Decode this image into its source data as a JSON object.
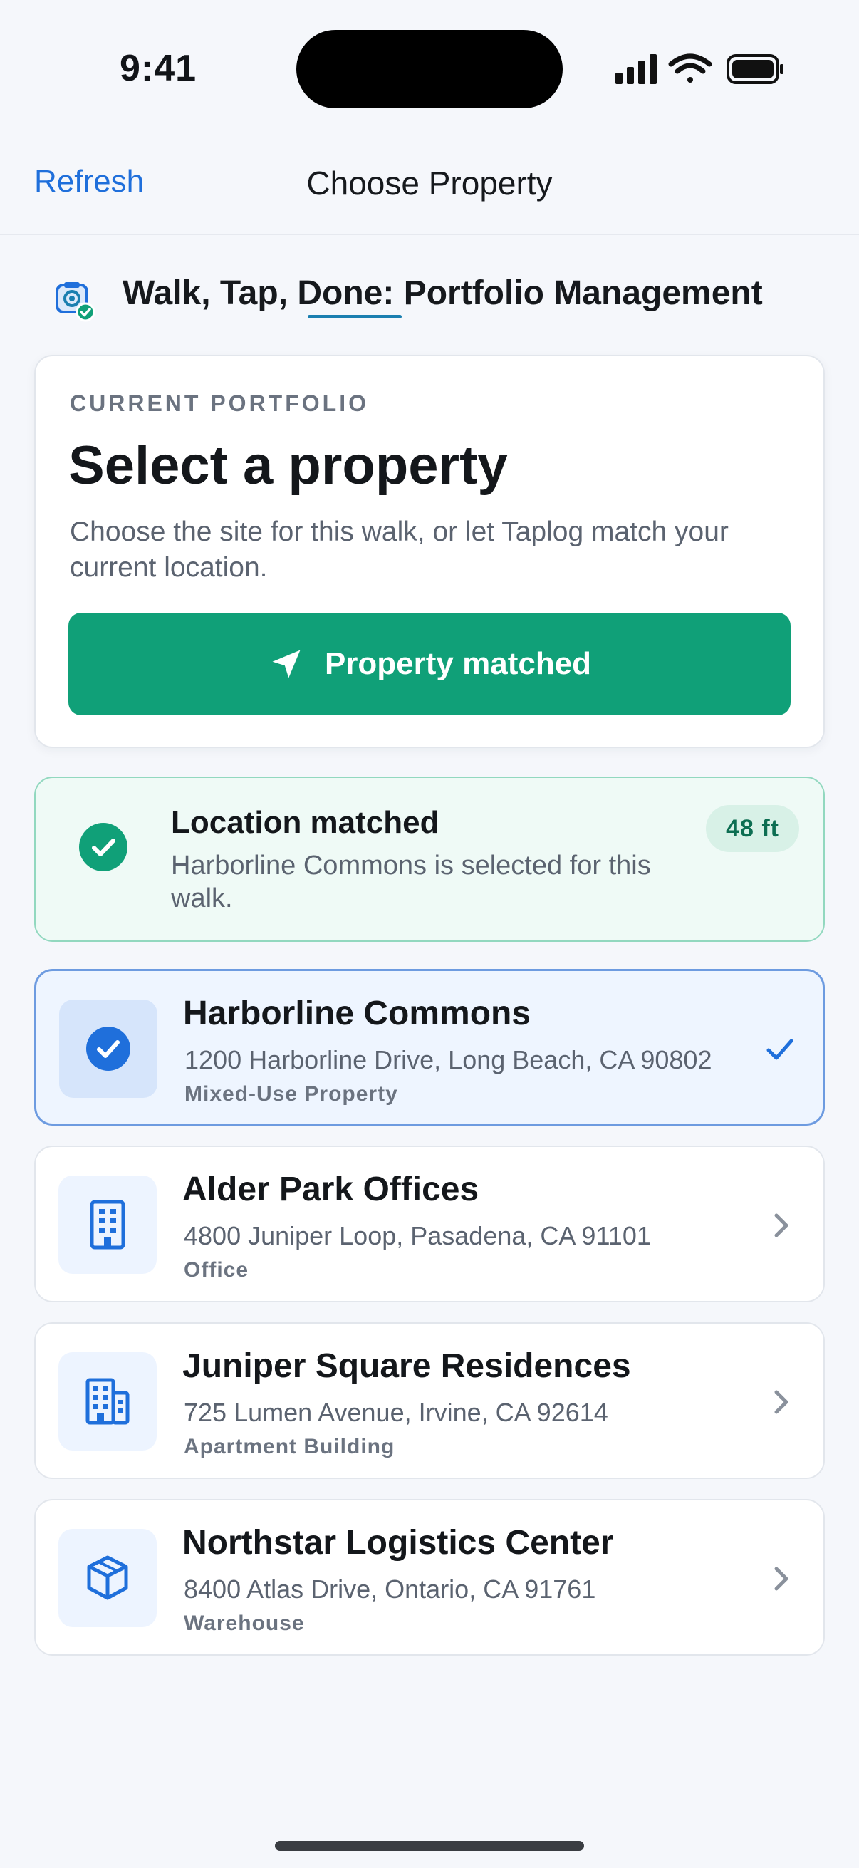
{
  "status_bar": {
    "time": "9:41"
  },
  "nav": {
    "refresh_label": "Refresh",
    "title": "Choose Property"
  },
  "app": {
    "title": "Walk, Tap, Done: Portfolio Management"
  },
  "portfolio_card": {
    "eyebrow": "CURRENT PORTFOLIO",
    "heading": "Select a property",
    "description": "Choose the site for this walk, or let Taplog match your current location.",
    "button_label": "Property matched"
  },
  "match_banner": {
    "title": "Location matched",
    "description": "Harborline Commons is selected for this walk.",
    "distance": "48 ft"
  },
  "properties": [
    {
      "name": "Harborline Commons",
      "address": "1200 Harborline Drive, Long Beach, CA 90802",
      "type": "Mixed-Use Property",
      "icon": "check-circle-icon",
      "selected": true
    },
    {
      "name": "Alder Park Offices",
      "address": "4800 Juniper Loop, Pasadena, CA 91101",
      "type": "Office",
      "icon": "office-building-icon",
      "selected": false
    },
    {
      "name": "Juniper Square Residences",
      "address": "725 Lumen Avenue, Irvine, CA 92614",
      "type": "Apartment Building",
      "icon": "apartment-building-icon",
      "selected": false
    },
    {
      "name": "Northstar Logistics Center",
      "address": "8400 Atlas Drive, Ontario, CA 91761",
      "type": "Warehouse",
      "icon": "package-box-icon",
      "selected": false
    }
  ],
  "colors": {
    "accent_blue": "#1f6fdb",
    "success_green": "#10a078",
    "banner_bg": "#effaf6",
    "selected_bg": "#eef5ff"
  }
}
